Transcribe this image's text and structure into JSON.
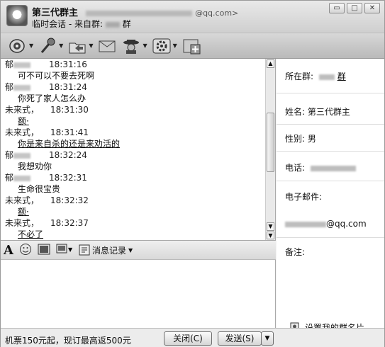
{
  "window": {
    "title": "第三代群主",
    "title_email_tail": "@qq.com>",
    "subtitle_prefix": "临时会话 - 来自群:",
    "subtitle_suffix": "群",
    "controls": [
      "▭",
      "□",
      "✕"
    ]
  },
  "toolbar": {
    "items": [
      {
        "icon": "video-camera-icon",
        "has_dropdown": true
      },
      {
        "icon": "microphone-icon",
        "has_dropdown": true
      },
      {
        "icon": "folder-send-file-icon",
        "has_dropdown": true
      },
      {
        "icon": "mail-icon",
        "has_dropdown": false
      },
      {
        "icon": "hat-avatar-icon",
        "has_dropdown": true
      },
      {
        "icon": "app-gear-icon",
        "has_dropdown": true
      },
      {
        "icon": "add-window-icon",
        "has_dropdown": false
      }
    ]
  },
  "chat": {
    "messages": [
      {
        "sender": "郁",
        "time": "18:31:16",
        "text": "可不可以不要去死啊",
        "underline": false
      },
      {
        "sender": "郁",
        "time": "18:31:24",
        "text": "你死了家人怎么办",
        "underline": false
      },
      {
        "sender": "未来式，",
        "time": "18:31:30",
        "text": "额·",
        "underline": true
      },
      {
        "sender": "未来式，",
        "time": "18:31:41",
        "text": "你是来自杀的还是来劝活的",
        "underline": true
      },
      {
        "sender": "郁",
        "time": "18:32:24",
        "text": "我想劝你",
        "underline": false
      },
      {
        "sender": "郁",
        "time": "18:32:31",
        "text": "生命很宝贵",
        "underline": false
      },
      {
        "sender": "未来式，",
        "time": "18:32:32",
        "text": "额·",
        "underline": true
      },
      {
        "sender": "未来式，",
        "time": "18:32:37",
        "text": "不必了",
        "underline": true
      }
    ]
  },
  "input_toolbar": {
    "font_label": "A",
    "history_label": "消息记录"
  },
  "bottom": {
    "ad_text": "机票150元起，现订最高返500元",
    "close_label": "关闭(C)",
    "send_label": "发送(S)"
  },
  "panel": {
    "group_label": "所在群:",
    "group_suffix": "群",
    "name_label": "姓名:",
    "name_value": "第三代群主",
    "gender_label": "性别:",
    "gender_value": "男",
    "phone_label": "电话:",
    "email_label": "电子邮件:",
    "email_tail": "@qq.com",
    "note_label": "备注:",
    "card_link": "设置我的群名片"
  }
}
